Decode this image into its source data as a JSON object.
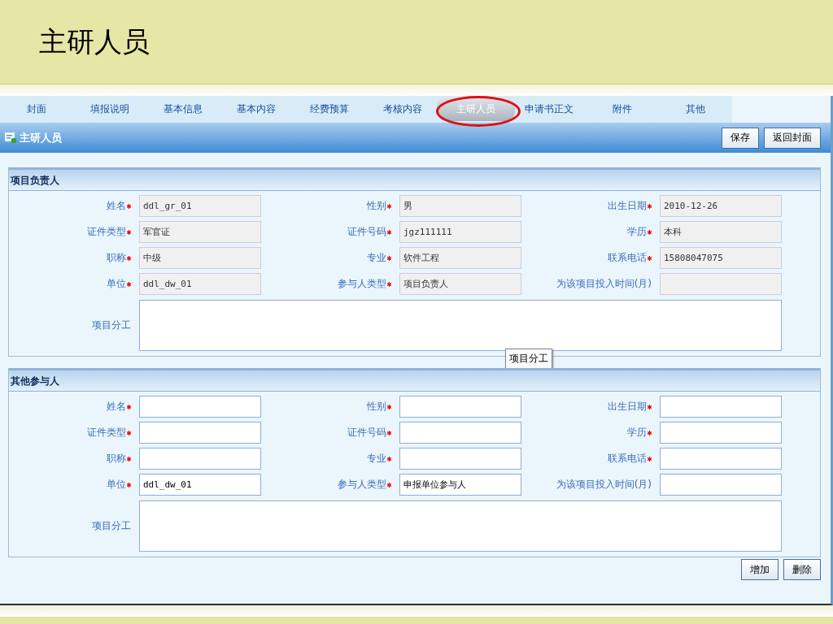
{
  "slide_title": "主研人员",
  "tabs": [
    {
      "label": "封面",
      "selected": false,
      "circled": false
    },
    {
      "label": "填报说明",
      "selected": false,
      "circled": false
    },
    {
      "label": "基本信息",
      "selected": false,
      "circled": false
    },
    {
      "label": "基本内容",
      "selected": false,
      "circled": false
    },
    {
      "label": "经费预算",
      "selected": false,
      "circled": false
    },
    {
      "label": "考核内容",
      "selected": false,
      "circled": false
    },
    {
      "label": "主研人员",
      "selected": true,
      "circled": true
    },
    {
      "label": "申请书正文",
      "selected": false,
      "circled": false
    },
    {
      "label": "附件",
      "selected": false,
      "circled": false
    },
    {
      "label": "其他",
      "selected": false,
      "circled": false
    }
  ],
  "panel": {
    "title": "主研人员",
    "buttons": [
      "保存",
      "返回封面"
    ]
  },
  "sections": [
    {
      "title": "项目负责人",
      "disabled": true,
      "fields": [
        {
          "label": "姓名",
          "required": true,
          "value": "ddl_gr_01"
        },
        {
          "label": "性别",
          "required": true,
          "value": "男"
        },
        {
          "label": "出生日期",
          "required": true,
          "value": "2010-12-26"
        },
        {
          "label": "证件类型",
          "required": true,
          "value": "军官证"
        },
        {
          "label": "证件号码",
          "required": true,
          "value": "jgz111111"
        },
        {
          "label": "学历",
          "required": true,
          "value": "本科"
        },
        {
          "label": "职称",
          "required": true,
          "value": "中级"
        },
        {
          "label": "专业",
          "required": true,
          "value": "软件工程"
        },
        {
          "label": "联系电话",
          "required": true,
          "value": "15808047075"
        },
        {
          "label": "单位",
          "required": true,
          "value": "ddl_dw_01"
        },
        {
          "label": "参与人类型",
          "required": true,
          "value": "项目负责人"
        },
        {
          "label": "为该项目投入时间(月)",
          "required": false
        }
      ],
      "textarea": {
        "label": "项目分工"
      },
      "tooltip": "项目分工"
    },
    {
      "title": "其他参与人",
      "disabled": false,
      "fields": [
        {
          "label": "姓名",
          "required": true
        },
        {
          "label": "性别",
          "required": true
        },
        {
          "label": "出生日期",
          "required": true
        },
        {
          "label": "证件类型",
          "required": true
        },
        {
          "label": "证件号码",
          "required": true
        },
        {
          "label": "学历",
          "required": true
        },
        {
          "label": "职称",
          "required": true
        },
        {
          "label": "专业",
          "required": true
        },
        {
          "label": "联系电话",
          "required": true
        },
        {
          "label": "单位",
          "required": true,
          "value": "ddl_dw_01"
        },
        {
          "label": "参与人类型",
          "required": true,
          "value": "申报单位参与人"
        },
        {
          "label": "为该项目投入时间(月)",
          "required": false
        }
      ],
      "textarea": {
        "label": "项目分工"
      }
    }
  ],
  "bottom_buttons": [
    "增加",
    "删除"
  ]
}
